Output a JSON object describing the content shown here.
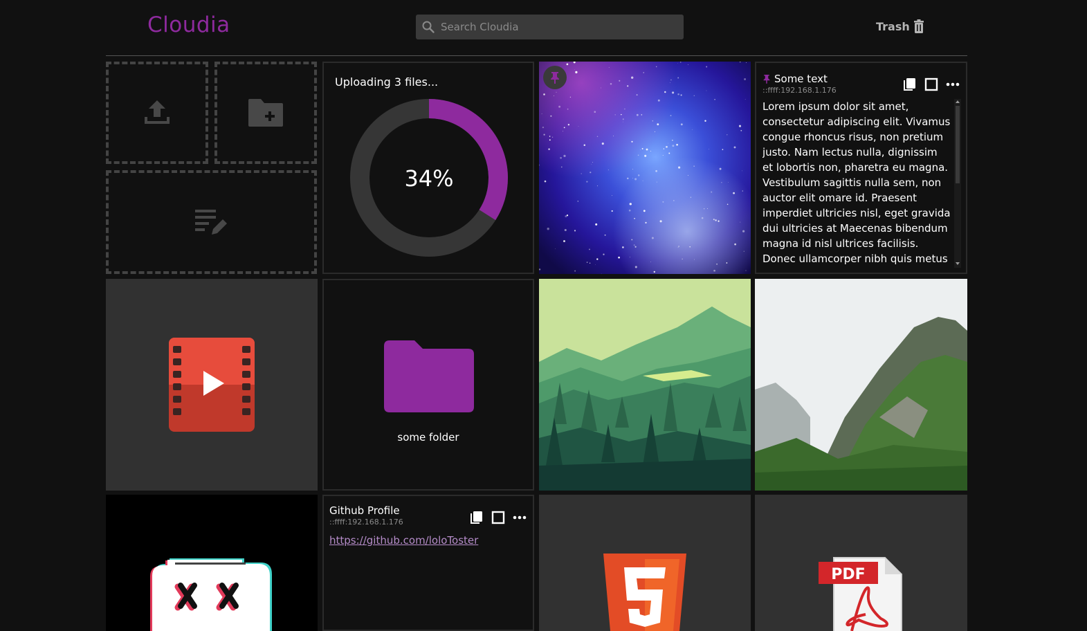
{
  "app": {
    "title": "Cloudia",
    "brand_color": "#8e2a9e"
  },
  "search": {
    "placeholder": "Search Cloudia",
    "value": "",
    "icon": "search-icon"
  },
  "header": {
    "trash_label": "Trash",
    "trash_icon": "trash-icon"
  },
  "upload_actions": [
    {
      "name": "upload-file-button",
      "icon": "upload-icon"
    },
    {
      "name": "new-folder-button",
      "icon": "folder-plus-icon"
    },
    {
      "name": "new-note-button",
      "icon": "note-edit-icon"
    }
  ],
  "upload_progress": {
    "title": "Uploading 3 files...",
    "percent_label": "34%",
    "progress": 0.34,
    "accent": "#8e2a9e"
  },
  "text_note": {
    "title": "Some text",
    "source": "::ffff:192.168.1.176",
    "pinned": true,
    "body": "Lorem ipsum dolor sit amet, consectetur adipiscing elit. Vivamus congue rhoncus risus, non pretium justo. Nam lectus nulla, dignissim et lobortis non, pharetra eu magna. Vestibulum sagittis nulla sem, non auctor elit omare id. Praesent imperdiet ultricies nisl, eget gravida dui ultricies at Maecenas bibendum magna id nisl ultrices facilisis. Donec ullamcorper nibh quis metus congue"
  },
  "image_tiles": [
    {
      "name": "galaxy-image",
      "pinned": true
    },
    {
      "name": "forest-landscape-image"
    },
    {
      "name": "mountain-photo"
    }
  ],
  "video_tile": {
    "icon": "video-file-icon",
    "accent": "#e04b3f"
  },
  "folder_tile": {
    "label": "some folder",
    "icon": "folder-icon"
  },
  "link_note": {
    "title": "Github Profile",
    "source": "::ffff:192.168.1.176",
    "url": "https://github.com/loloToster"
  },
  "file_tiles": [
    {
      "name": "glitch-mascot-image"
    },
    {
      "name": "html5-file",
      "icon": "html5-icon",
      "accent": "#e34c26"
    },
    {
      "name": "pdf-file",
      "icon": "pdf-icon",
      "badge": "PDF",
      "accent": "#d3262a"
    }
  ],
  "note_actions": [
    "copy-icon",
    "select-icon",
    "more-icon"
  ]
}
